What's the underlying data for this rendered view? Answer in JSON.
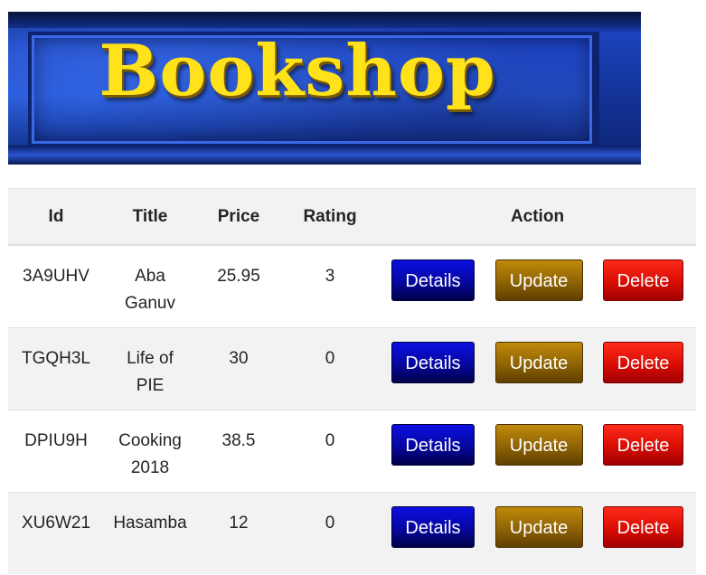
{
  "banner": {
    "text": "Bookshop",
    "text_color": "#ffe21a",
    "background_color": "#1f47c9"
  },
  "table": {
    "headers": {
      "id": "Id",
      "title": "Title",
      "price": "Price",
      "rating": "Rating",
      "action": "Action"
    },
    "rows": [
      {
        "id": "3A9UHV",
        "title": "Aba Ganuv",
        "price": "25.95",
        "rating": "3"
      },
      {
        "id": "TGQH3L",
        "title": "Life of PIE",
        "price": "30",
        "rating": "0"
      },
      {
        "id": "DPIU9H",
        "title": "Cooking 2018",
        "price": "38.5",
        "rating": "0"
      },
      {
        "id": "XU6W21",
        "title": "Hasamba",
        "price": "12",
        "rating": "0"
      }
    ],
    "buttons": {
      "details": "Details",
      "update": "Update",
      "delete": "Delete"
    }
  },
  "colors": {
    "details_button": "#0607a0",
    "update_button": "#8e6305",
    "delete_button": "#d90d05",
    "stripe": "#f2f2f2"
  }
}
